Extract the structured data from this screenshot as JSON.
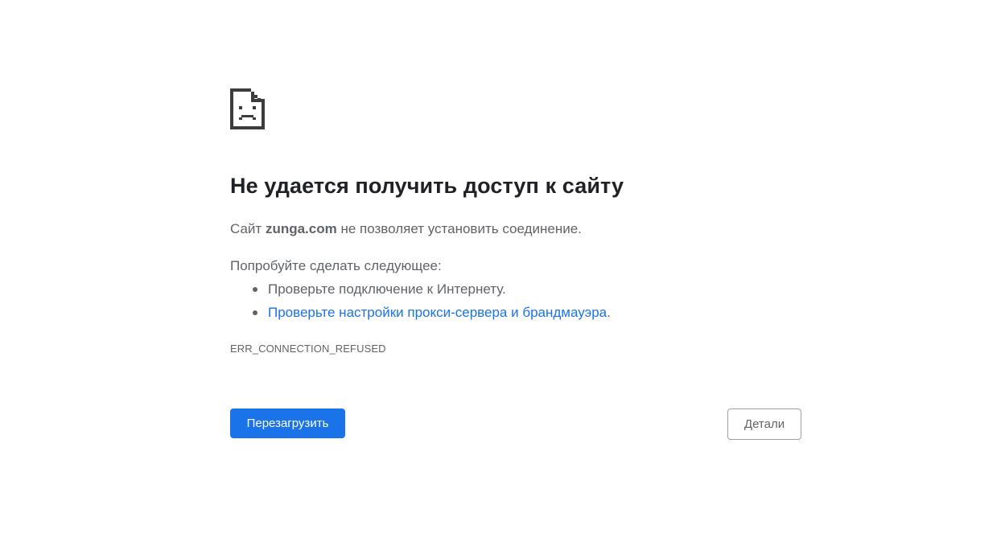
{
  "error_page": {
    "icon": "sad-document-icon",
    "title": "Не удается получить доступ к сайту",
    "desc_prefix": "Сайт ",
    "host": "zunga.com",
    "desc_suffix": " не позволяет установить соединение.",
    "try_heading": "Попробуйте сделать следующее:",
    "suggestions": [
      {
        "text": "Проверьте подключение к Интернету."
      },
      {
        "link_text": "Проверьте настройки прокси-сервера и брандмауэра",
        "trailing": "."
      }
    ],
    "error_code": "ERR_CONNECTION_REFUSED",
    "reload_label": "Перезагрузить",
    "details_label": "Детали"
  },
  "colors": {
    "primary": "#1a73e8",
    "text": "#5f6368",
    "title": "#202124",
    "icon": "#3c3c3c"
  }
}
